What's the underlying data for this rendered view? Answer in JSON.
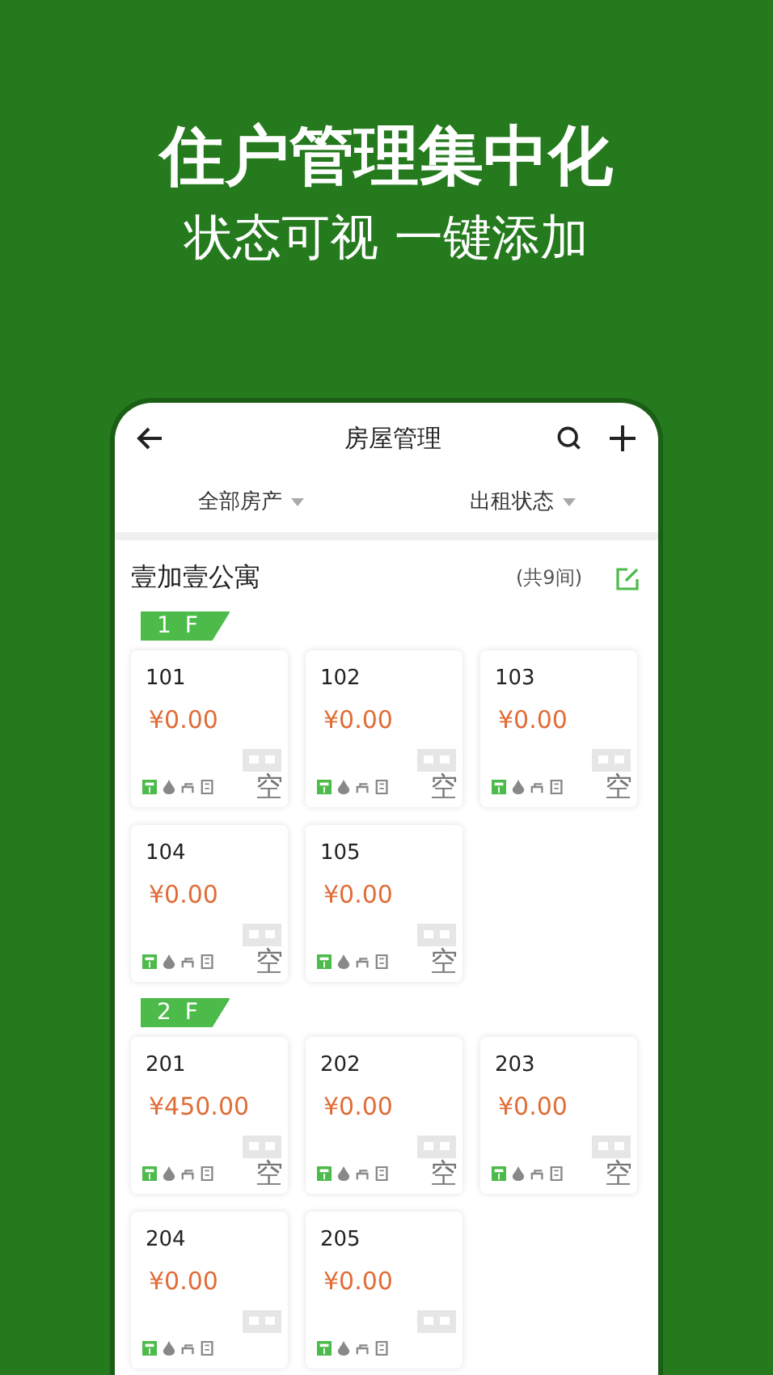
{
  "promo": {
    "headline": "住户管理集中化",
    "subline": "状态可视  一键添加"
  },
  "header": {
    "title": "房屋管理"
  },
  "filters": [
    {
      "label": "全部房产"
    },
    {
      "label": "出租状态"
    }
  ],
  "property": {
    "name": "壹加壹公寓",
    "count": "(共9间)"
  },
  "floors": [
    {
      "label": "1 F",
      "rooms": [
        {
          "number": "101",
          "price": "¥0.00",
          "status": "空"
        },
        {
          "number": "102",
          "price": "¥0.00",
          "status": "空"
        },
        {
          "number": "103",
          "price": "¥0.00",
          "status": "空"
        },
        {
          "number": "104",
          "price": "¥0.00",
          "status": "空"
        },
        {
          "number": "105",
          "price": "¥0.00",
          "status": "空"
        }
      ]
    },
    {
      "label": "2 F",
      "rooms": [
        {
          "number": "201",
          "price": "¥450.00",
          "status": "空"
        },
        {
          "number": "202",
          "price": "¥0.00",
          "status": "空"
        },
        {
          "number": "203",
          "price": "¥0.00",
          "status": "空"
        },
        {
          "number": "204",
          "price": "¥0.00"
        },
        {
          "number": "205",
          "price": "¥0.00"
        }
      ]
    }
  ]
}
